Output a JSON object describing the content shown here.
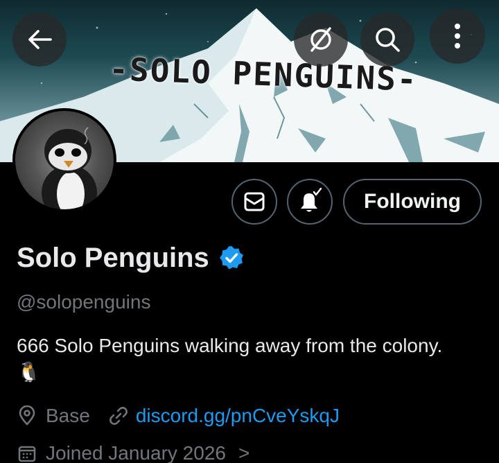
{
  "banner": {
    "title": "-SOLO PENGUINS-"
  },
  "header_buttons": {
    "back_icon": "arrow-left-icon",
    "grok_icon": "slashed-circle-icon",
    "search_icon": "search-icon",
    "more_icon": "vertical-dots-icon"
  },
  "actions": {
    "message_icon": "envelope-icon",
    "notify_icon": "bell-check-icon",
    "follow_label": "Following"
  },
  "profile": {
    "display_name": "Solo Penguins",
    "verified": true,
    "handle": "@solopenguins",
    "bio": "666 Solo Penguins walking away from the colony. 🐧",
    "location": "Base",
    "website": "discord.gg/pnCveYskqJ",
    "joined": "Joined January 2026",
    "joined_chevron": ">"
  },
  "colors": {
    "background": "#000000",
    "text_primary": "#e7e9ea",
    "text_secondary": "#71767b",
    "link": "#1d9bf0",
    "border": "#536471",
    "verified_badge": "#1d9bf0"
  }
}
